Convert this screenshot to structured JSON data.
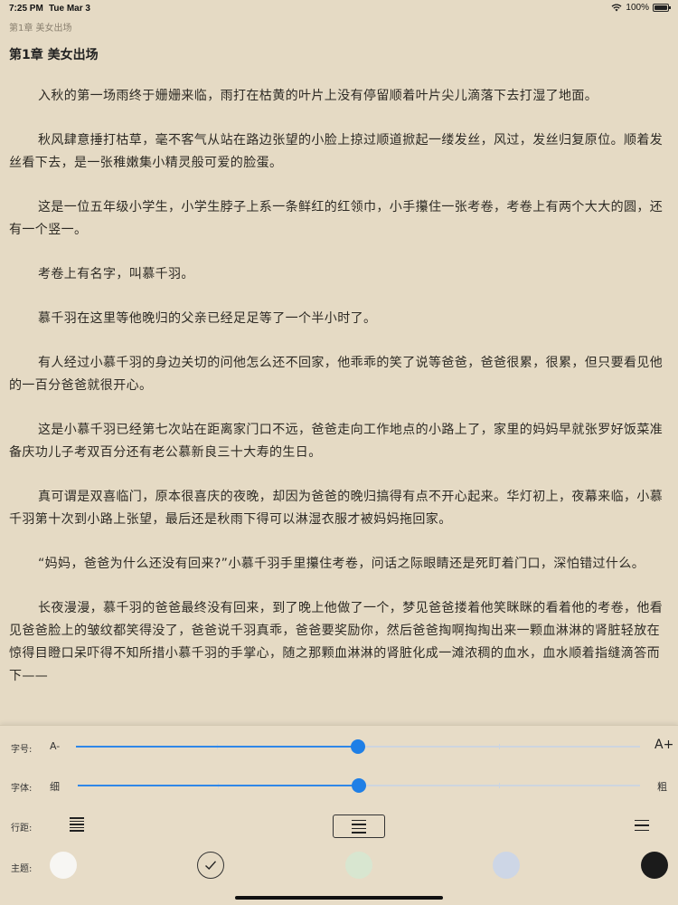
{
  "status": {
    "time": "7:25 PM",
    "date": "Tue Mar 3",
    "battery": "100%",
    "battery_level": 1.0
  },
  "header": {
    "title": "第1章 美女出场"
  },
  "chapter_title": "第1章 美女出场",
  "paragraphs": [
    "入秋的第一场雨终于姗姗来临，雨打在枯黄的叶片上没有停留顺着叶片尖儿滴落下去打湿了地面。",
    "秋风肆意捶打枯草，毫不客气从站在路边张望的小脸上掠过顺道掀起一缕发丝，风过，发丝归复原位。顺着发丝看下去，是一张稚嫩集小精灵般可爱的脸蛋。",
    "这是一位五年级小学生，小学生脖子上系一条鲜红的红领巾，小手攥住一张考卷，考卷上有两个大大的圆，还有一个竖一。",
    "考卷上有名字，叫慕千羽。",
    "慕千羽在这里等他晚归的父亲已经足足等了一个半小时了。",
    "有人经过小慕千羽的身边关切的问他怎么还不回家，他乖乖的笑了说等爸爸，爸爸很累，很累，但只要看见他的一百分爸爸就很开心。",
    "这是小慕千羽已经第七次站在距离家门口不远，爸爸走向工作地点的小路上了，家里的妈妈早就张罗好饭菜准备庆功儿子考双百分还有老公慕新良三十大寿的生日。",
    "真可谓是双喜临门，原本很喜庆的夜晚，却因为爸爸的晚归搞得有点不开心起来。华灯初上，夜幕来临，小慕千羽第十次到小路上张望，最后还是秋雨下得可以淋湿衣服才被妈妈拖回家。",
    "“妈妈，爸爸为什么还没有回来?”小慕千羽手里攥住考卷，问话之际眼睛还是死盯着门口，深怕错过什么。",
    "长夜漫漫，慕千羽的爸爸最终没有回来，到了晚上他做了一个，梦见爸爸搂着他笑眯眯的看着他的考卷，他看见爸爸脸上的皱纹都笑得没了，爸爸说千羽真乖，爸爸要奖励你，然后爸爸掏啊掏掏出来一颗血淋淋的肾脏轻放在惊得目瞪口呆吓得不知所措小慕千羽的手掌心，随之那颗血淋淋的肾脏化成一滩浓稠的血水，血水顺着指缝滴答而下——"
  ],
  "settings": {
    "font_size": {
      "label": "字号:",
      "min_label": "A-",
      "max_label": "A+",
      "value": 0.5
    },
    "font_weight": {
      "label": "字体:",
      "min_label": "细",
      "max_label": "粗",
      "value": 0.5
    },
    "line_spacing": {
      "label": "行距:",
      "options": [
        "compact",
        "normal",
        "loose"
      ],
      "selected": "normal"
    },
    "theme": {
      "label": "主题:",
      "options": [
        "#f7f6f3",
        "#e5dac4",
        "#d8e6d0",
        "#cdd6e6",
        "#1b1b1b"
      ],
      "selected": 1
    }
  }
}
